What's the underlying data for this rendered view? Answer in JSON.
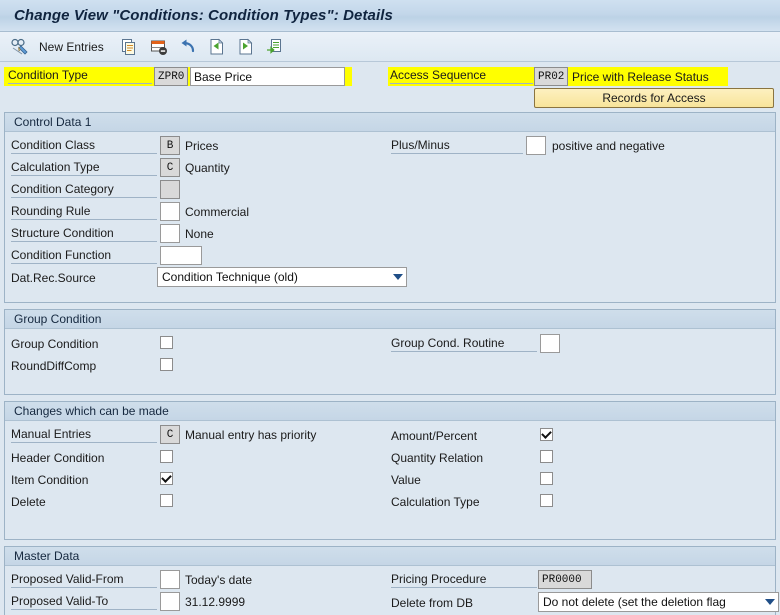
{
  "window": {
    "title": "Change View \"Conditions: Condition Types\": Details"
  },
  "toolbar": {
    "items": [
      {
        "icon": "display-change-glasses-pencil-icon",
        "label": ""
      },
      {
        "icon": "",
        "label": "New Entries"
      },
      {
        "icon": "copy-icon",
        "label": ""
      },
      {
        "icon": "delete-row-icon",
        "label": ""
      },
      {
        "icon": "undo-icon",
        "label": ""
      },
      {
        "icon": "previous-entry-icon",
        "label": ""
      },
      {
        "icon": "next-entry-icon",
        "label": ""
      },
      {
        "icon": "details-table-icon",
        "label": ""
      }
    ],
    "new_entries_label": "New Entries"
  },
  "header": {
    "condition_type_label": "Condition Type",
    "condition_type_key": "ZPR0",
    "condition_type_text": "Base Price",
    "access_sequence_label": "Access Sequence",
    "access_sequence_key": "PR02",
    "access_sequence_text": "Price with Release Status",
    "records_for_access_label": "Records for Access"
  },
  "control_data_1": {
    "title": "Control Data 1",
    "left": [
      {
        "label": "Condition Class",
        "key": "B",
        "text": "Prices"
      },
      {
        "label": "Calculation Type",
        "key": "C",
        "text": "Quantity"
      },
      {
        "label": "Condition Category",
        "key": "",
        "text": ""
      },
      {
        "label": "Rounding Rule",
        "key": "",
        "text": "Commercial"
      },
      {
        "label": "Structure Condition",
        "key": "",
        "text": "None"
      },
      {
        "label": "Condition Function",
        "key": "",
        "text": ""
      }
    ],
    "dat_rec_source_label": "Dat.Rec.Source",
    "dat_rec_source_value": "Condition Technique (old)",
    "right": [
      {
        "label": "Plus/Minus",
        "key": "",
        "text": "positive and negative"
      }
    ]
  },
  "group_condition": {
    "title": "Group Condition",
    "left": [
      {
        "label": "Group Condition",
        "checked": false
      },
      {
        "label": "RoundDiffComp",
        "checked": false
      }
    ],
    "right": {
      "routine_label": "Group Cond. Routine",
      "routine_value": ""
    }
  },
  "changes": {
    "title": "Changes which can be made",
    "manual_entries_label": "Manual Entries",
    "manual_entries_key": "C",
    "manual_entries_text": "Manual entry has priority",
    "left": [
      {
        "label": "Header Condition",
        "checked": false
      },
      {
        "label": "Item Condition",
        "checked": true
      },
      {
        "label": "Delete",
        "checked": false
      }
    ],
    "right": [
      {
        "label": "Amount/Percent",
        "checked": true
      },
      {
        "label": "Quantity Relation",
        "checked": false
      },
      {
        "label": "Value",
        "checked": false
      },
      {
        "label": "Calculation Type",
        "checked": false
      }
    ]
  },
  "master_data": {
    "title": "Master Data",
    "proposed_valid_from_label": "Proposed Valid-From",
    "proposed_valid_from_key": "",
    "proposed_valid_from_text": "Today's date",
    "proposed_valid_to_label": "Proposed Valid-To",
    "proposed_valid_to_key": "",
    "proposed_valid_to_text": "31.12.9999",
    "pricing_procedure_label": "Pricing Procedure",
    "pricing_procedure_value": "PR0000",
    "delete_from_db_label": "Delete from DB",
    "delete_from_db_value": "Do not delete (set the deletion flag"
  },
  "colors": {
    "highlight": "#ffff00",
    "title_text": "#10243f",
    "background": "#dde7f0",
    "button_yellow": "#f8e49a"
  }
}
